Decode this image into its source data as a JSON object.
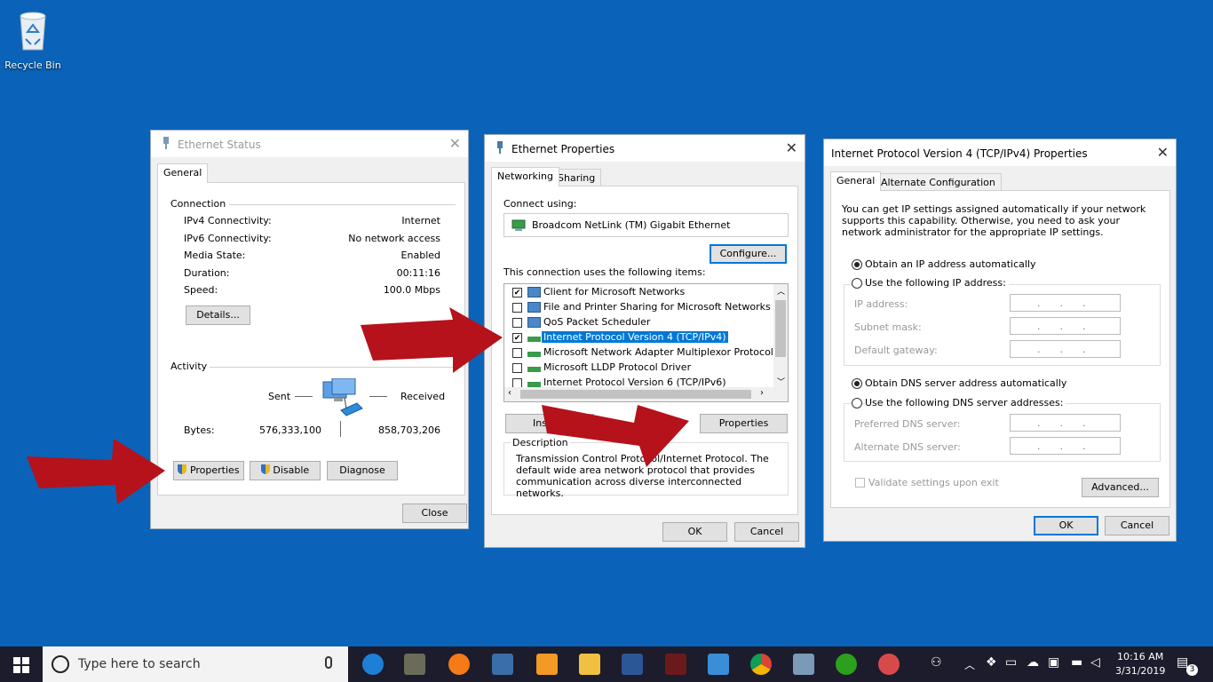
{
  "desktop": {
    "recycle_bin_label": "Recycle Bin"
  },
  "ethernet_status": {
    "title": "Ethernet Status",
    "tab_general": "General",
    "group_connection": "Connection",
    "rows": [
      {
        "label": "IPv4 Connectivity:",
        "value": "Internet"
      },
      {
        "label": "IPv6 Connectivity:",
        "value": "No network access"
      },
      {
        "label": "Media State:",
        "value": "Enabled"
      },
      {
        "label": "Duration:",
        "value": "00:11:16"
      },
      {
        "label": "Speed:",
        "value": "100.0 Mbps"
      }
    ],
    "details_button": "Details...",
    "group_activity": "Activity",
    "sent_label": "Sent",
    "received_label": "Received",
    "bytes_label": "Bytes:",
    "bytes_sent": "576,333,100",
    "bytes_received": "858,703,206",
    "properties_button": "Properties",
    "disable_button": "Disable",
    "diagnose_button": "Diagnose",
    "close_button": "Close"
  },
  "ethernet_properties": {
    "title": "Ethernet Properties",
    "tab_networking": "Networking",
    "tab_sharing": "Sharing",
    "connect_using_label": "Connect using:",
    "adapter_name": "Broadcom NetLink (TM) Gigabit Ethernet",
    "configure_button": "Configure...",
    "items_label": "This connection uses the following items:",
    "items": [
      {
        "label": "Client for Microsoft Networks",
        "checked": "✔"
      },
      {
        "label": "File and Printer Sharing for Microsoft Networks",
        "checked": ""
      },
      {
        "label": "QoS Packet Scheduler",
        "checked": ""
      },
      {
        "label": "Internet Protocol Version 4 (TCP/IPv4)",
        "checked": "✔"
      },
      {
        "label": "Microsoft Network Adapter Multiplexor Protocol",
        "checked": ""
      },
      {
        "label": "Microsoft LLDP Protocol Driver",
        "checked": ""
      },
      {
        "label": "Internet Protocol Version 6 (TCP/IPv6)",
        "checked": ""
      }
    ],
    "install_button": "Insta",
    "properties_button": "Properties",
    "description_label": "Description",
    "description_text": "Transmission Control Protocol/Internet Protocol. The default wide area network protocol that provides communication across diverse interconnected networks.",
    "ok_button": "OK",
    "cancel_button": "Cancel"
  },
  "ipv4_properties": {
    "title": "Internet Protocol Version 4 (TCP/IPv4) Properties",
    "tab_general": "General",
    "tab_alternate": "Alternate Configuration",
    "intro": "You can get IP settings assigned automatically if your network supports this capability. Otherwise, you need to ask your network administrator for the appropriate IP settings.",
    "obtain_ip_auto": "Obtain an IP address automatically",
    "use_following_ip": "Use the following IP address:",
    "ip_address_label": "IP address:",
    "subnet_mask_label": "Subnet mask:",
    "default_gateway_label": "Default gateway:",
    "obtain_dns_auto": "Obtain DNS server address automatically",
    "use_following_dns": "Use the following DNS server addresses:",
    "preferred_dns_label": "Preferred DNS server:",
    "alternate_dns_label": "Alternate DNS server:",
    "ip_placeholder": "...",
    "validate_label": "Validate settings upon exit",
    "advanced_button": "Advanced...",
    "ok_button": "OK",
    "cancel_button": "Cancel"
  },
  "taskbar": {
    "search_placeholder": "Type here to search",
    "time": "10:16 AM",
    "date": "3/31/2019",
    "notification_count": "3"
  },
  "colors": {
    "desktop": "#0a63b8",
    "arrow": "#b5121b",
    "accent": "#0078d7"
  }
}
